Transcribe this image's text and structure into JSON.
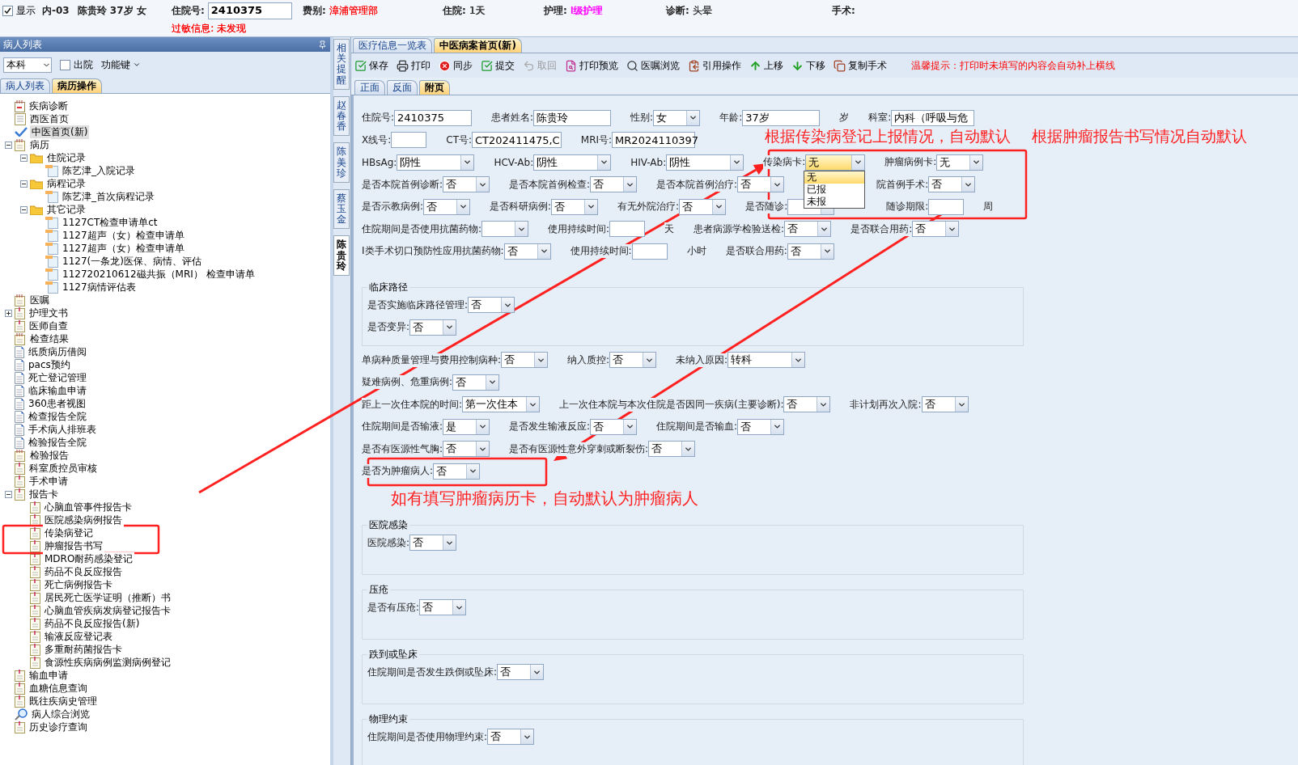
{
  "header": {
    "show_checkbox": {
      "label": "显示",
      "checked": true
    },
    "ward": "内-03",
    "patient": "陈贵玲 37岁 女",
    "fields": [
      {
        "label": "住院号:",
        "kind": "input",
        "value": "2410375"
      },
      {
        "label": "费别:",
        "kind": "text",
        "value": "漳浦管理部",
        "color": "#ff0000"
      },
      {
        "label": "住院:",
        "kind": "text",
        "value": "1天",
        "color": "#333333"
      },
      {
        "label": "护理:",
        "kind": "text",
        "value": "I级护理",
        "color": "#ff00ff"
      },
      {
        "label": "诊断:",
        "kind": "text",
        "value": "头晕",
        "color": "#333333"
      },
      {
        "label": "手术:",
        "kind": "text"
      }
    ],
    "allergy": {
      "label": "过敏信息:",
      "value": "未发现"
    }
  },
  "left_panel": {
    "title": "病人列表",
    "dept_select": "本科",
    "discharged": {
      "label": "出院",
      "checked": false
    },
    "function_menu": "功能键",
    "tabs": [
      {
        "label": "病人列表",
        "selected": false
      },
      {
        "label": "病历操作",
        "selected": true
      }
    ],
    "tree": [
      {
        "label": "疾病诊断",
        "kind": "calendar",
        "selected": false
      },
      {
        "label": "西医首页",
        "kind": "doc",
        "selected": false
      },
      {
        "label": "中医首页(新)",
        "kind": "check",
        "selected": true
      },
      {
        "label": "病历",
        "kind": "notebook",
        "selected": false,
        "expanded": true,
        "children": [
          {
            "label": "住院记录",
            "kind": "folder",
            "selected": false,
            "expanded": true,
            "children": [
              {
                "label": "陈艺津_入院记录",
                "kind": "record",
                "selected": false
              }
            ]
          },
          {
            "label": "病程记录",
            "kind": "folder",
            "selected": false,
            "expanded": true,
            "children": [
              {
                "label": "陈艺津_首次病程记录",
                "kind": "record",
                "selected": false
              }
            ]
          },
          {
            "label": "其它记录",
            "kind": "folder",
            "selected": false,
            "expanded": true,
            "children": [
              {
                "label": "1127CT检查申请单ct",
                "kind": "record",
                "selected": false
              },
              {
                "label": "1127超声（女）检查申请单",
                "kind": "record",
                "selected": false
              },
              {
                "label": "1127超声（女）检查申请单",
                "kind": "record",
                "selected": false
              },
              {
                "label": "1127(一条龙)医保、病情、评估",
                "kind": "record",
                "selected": false
              },
              {
                "label": "112720210612磁共振（MRI） 检查申请单",
                "kind": "record",
                "selected": false
              },
              {
                "label": "1127病情评估表",
                "kind": "record",
                "selected": false
              }
            ]
          }
        ]
      },
      {
        "label": "医嘱",
        "kind": "notebook",
        "selected": false
      },
      {
        "label": "护理文书",
        "kind": "clipboard",
        "selected": false,
        "expanded": false
      },
      {
        "label": "医师自查",
        "kind": "clipboard",
        "selected": false
      },
      {
        "label": "检查结果",
        "kind": "notebook",
        "selected": false
      },
      {
        "label": "纸质病历借阅",
        "kind": "page",
        "selected": false
      },
      {
        "label": "pacs预约",
        "kind": "page",
        "selected": false
      },
      {
        "label": "死亡登记管理",
        "kind": "page",
        "selected": false
      },
      {
        "label": "临床输血申请",
        "kind": "page",
        "selected": false
      },
      {
        "label": "360患者视图",
        "kind": "page",
        "selected": false
      },
      {
        "label": "检查报告全院",
        "kind": "page",
        "selected": false
      },
      {
        "label": "手术病人排班表",
        "kind": "page",
        "selected": false
      },
      {
        "label": "检验报告全院",
        "kind": "page",
        "selected": false
      },
      {
        "label": "检验报告",
        "kind": "notebook",
        "selected": false
      },
      {
        "label": "科室质控员审核",
        "kind": "clipboard",
        "selected": false
      },
      {
        "label": "手术申请",
        "kind": "clipboard",
        "selected": false
      },
      {
        "label": "报告卡",
        "kind": "clipboard",
        "selected": false,
        "expanded": true,
        "children": [
          {
            "label": "心脑血管事件报告卡",
            "kind": "clipboard",
            "selected": false
          },
          {
            "label": "医院感染病例报告",
            "kind": "clipboard",
            "selected": false
          },
          {
            "label": "传染病登记",
            "kind": "clipboard",
            "selected": false
          },
          {
            "label": "肿瘤报告书写",
            "kind": "clipboard",
            "selected": false
          },
          {
            "label": "MDRO耐药感染登记",
            "kind": "clipboard",
            "selected": false
          },
          {
            "label": "药品不良反应报告",
            "kind": "clipboard",
            "selected": false
          },
          {
            "label": "死亡病例报告卡",
            "kind": "clipboard",
            "selected": false
          },
          {
            "label": "居民死亡医学证明（推断）书",
            "kind": "clipboard",
            "selected": false
          },
          {
            "label": "心脑血管疾病发病登记报告卡",
            "kind": "clipboard",
            "selected": false
          },
          {
            "label": "药品不良反应报告(新)",
            "kind": "clipboard",
            "selected": false
          },
          {
            "label": "输液反应登记表",
            "kind": "clipboard",
            "selected": false
          },
          {
            "label": "多重耐药菌报告卡",
            "kind": "clipboard",
            "selected": false
          },
          {
            "label": "食源性疾病病例监测病例登记",
            "kind": "clipboard",
            "selected": false
          }
        ]
      },
      {
        "label": "输血申请",
        "kind": "clipboard",
        "selected": false
      },
      {
        "label": "血糖信息查询",
        "kind": "clipboard",
        "selected": false
      },
      {
        "label": "既往疾病史管理",
        "kind": "clipboard",
        "selected": false
      },
      {
        "label": "病人综合浏览",
        "kind": "search",
        "selected": false
      },
      {
        "label": "历史诊疗查询",
        "kind": "clipboard",
        "selected": false
      }
    ]
  },
  "side_tabs": [
    {
      "label": "相关提醒",
      "selected": false
    },
    {
      "label": "赵春香",
      "selected": false
    },
    {
      "label": "陈美珍",
      "selected": false
    },
    {
      "label": "蔡玉金",
      "selected": false
    },
    {
      "label": "陈贵玲",
      "selected": true
    }
  ],
  "tabs": [
    {
      "label": "医疗信息一览表",
      "selected": false
    },
    {
      "label": "中医病案首页(新)",
      "selected": true
    }
  ],
  "toolbar": [
    {
      "label": "保存",
      "disabled": false
    },
    {
      "label": "打印",
      "disabled": false
    },
    {
      "label": "同步",
      "disabled": false
    },
    {
      "label": "提交",
      "disabled": false
    },
    {
      "label": "取回",
      "disabled": true
    },
    {
      "label": "打印预览",
      "disabled": false
    },
    {
      "label": "医嘱浏览",
      "disabled": false
    },
    {
      "label": "引用操作",
      "disabled": false
    },
    {
      "label": "上移",
      "disabled": false
    },
    {
      "label": "下移",
      "disabled": false
    },
    {
      "label": "复制手术",
      "disabled": false
    }
  ],
  "tip": "温馨提示：打印时未填写的内容会自动补上横线",
  "subtabs": [
    {
      "label": "正面",
      "selected": false
    },
    {
      "label": "反面",
      "selected": false
    },
    {
      "label": "附页",
      "selected": true
    }
  ],
  "callouts": [
    "根据传染病登记上报情况，自动默认",
    "根据肿瘤报告书写情况自动默认"
  ],
  "form": [
    {
      "kind": "rows",
      "rows": [
        {
          "fields": [
            {
              "label": "住院号:",
              "kind": "input",
              "value": "2410375"
            },
            {
              "label": "患者姓名:",
              "kind": "input",
              "value": "陈贵玲"
            },
            {
              "label": "性别:",
              "kind": "select",
              "value": "女"
            },
            {
              "label": "年龄:",
              "kind": "input",
              "value": "37岁"
            },
            {
              "label": "岁",
              "kind": "unit"
            },
            {
              "label": "科室:",
              "kind": "input",
              "value": "内科（呼吸与危"
            }
          ]
        },
        {
          "fields": [
            {
              "label": "X线号:",
              "kind": "input"
            },
            {
              "label": "CT号:",
              "kind": "input",
              "value": "CT202411475,C"
            },
            {
              "label": "MRI号:",
              "kind": "input",
              "value": "MR2024110397"
            }
          ]
        },
        {
          "fields": [
            {
              "label": "HBsAg:",
              "kind": "select",
              "value": "阴性"
            },
            {
              "label": "HCV-Ab:",
              "kind": "select",
              "value": "阴性"
            },
            {
              "label": "HIV-Ab:",
              "kind": "select",
              "value": "阴性"
            },
            {
              "label": "传染病卡:",
              "kind": "select",
              "value": "无",
              "open": true,
              "options": [
                {
                  "text": "无",
                  "selected": true
                },
                {
                  "text": "已报",
                  "selected": false
                },
                {
                  "text": "未报",
                  "selected": false
                }
              ]
            },
            {
              "label": "肿瘤病例卡:",
              "kind": "select",
              "value": "无"
            }
          ]
        },
        {
          "fields": [
            {
              "label": "是否本院首例诊断:",
              "kind": "select",
              "value": "否"
            },
            {
              "label": "是否本院首例检查:",
              "kind": "select",
              "value": "否"
            },
            {
              "label": "是否本院首例治疗:",
              "kind": "select",
              "value": "否"
            },
            {
              "label": "院首例手术:",
              "kind": "select",
              "value": "否"
            }
          ]
        },
        {
          "fields": [
            {
              "label": "是否示教病例:",
              "kind": "select",
              "value": "否"
            },
            {
              "label": "是否科研病例:",
              "kind": "select",
              "value": "否"
            },
            {
              "label": "有无外院治疗:",
              "kind": "select",
              "value": "否"
            },
            {
              "label": "是否随诊:",
              "kind": "select"
            },
            {
              "label": "随诊期限:",
              "kind": "input"
            },
            {
              "label": "周",
              "kind": "unit"
            }
          ]
        },
        {
          "fields": [
            {
              "label": "住院期间是否使用抗菌药物:",
              "kind": "select"
            },
            {
              "label": "使用持续时间:",
              "kind": "input"
            },
            {
              "label": "天",
              "kind": "unit"
            },
            {
              "label": "患者病源学检验送检:",
              "kind": "select",
              "value": "否"
            },
            {
              "label": "是否联合用药:",
              "kind": "select",
              "value": "否"
            }
          ]
        },
        {
          "fields": [
            {
              "label": "I类手术切口预防性应用抗菌药物:",
              "kind": "select",
              "value": "否"
            },
            {
              "label": "使用持续时间:",
              "kind": "input"
            },
            {
              "label": "小时",
              "kind": "unit"
            },
            {
              "label": "是否联合用药:",
              "kind": "select",
              "value": "否"
            }
          ]
        }
      ]
    },
    {
      "kind": "group",
      "title": "临床路径",
      "rows": [
        {
          "fields": [
            {
              "label": "是否实施临床路径管理:",
              "kind": "select",
              "value": "否"
            }
          ]
        },
        {
          "fields": [
            {
              "label": "是否变异:",
              "kind": "select",
              "value": "否"
            }
          ]
        }
      ]
    },
    {
      "kind": "rows",
      "rows": [
        {
          "fields": [
            {
              "label": "单病种质量管理与费用控制病种:",
              "kind": "select",
              "value": "否"
            },
            {
              "label": "纳入质控:",
              "kind": "select",
              "value": "否"
            },
            {
              "label": "未纳入原因:",
              "kind": "select",
              "value": "转科"
            }
          ]
        },
        {
          "fields": [
            {
              "label": "疑难病例、危重病例:",
              "kind": "select",
              "value": "否"
            }
          ]
        },
        {
          "fields": [
            {
              "label": "距上一次住本院的时间:",
              "kind": "select",
              "value": "第一次住本"
            },
            {
              "label": "上一次住本院与本次住院是否因同一疾病(主要诊断):",
              "kind": "select",
              "value": "否"
            },
            {
              "label": "非计划再次入院:",
              "kind": "select",
              "value": "否"
            }
          ]
        },
        {
          "fields": [
            {
              "label": "住院期间是否输液:",
              "kind": "select",
              "value": "是"
            },
            {
              "label": "是否发生输液反应:",
              "kind": "select",
              "value": "否"
            },
            {
              "label": "住院期间是否输血:",
              "kind": "select",
              "value": "否"
            }
          ]
        },
        {
          "fields": [
            {
              "label": "是否有医源性气胸:",
              "kind": "select",
              "value": "否"
            },
            {
              "label": "是否有医源性意外穿刺或断裂伤:",
              "kind": "select",
              "value": "否"
            }
          ]
        },
        {
          "fields": [
            {
              "label": "是否为肿瘤病人:",
              "kind": "select",
              "value": "否"
            }
          ]
        }
      ]
    },
    {
      "kind": "note",
      "text": "如有填写肿瘤病历卡，自动默认为肿瘤病人"
    },
    {
      "kind": "group",
      "title": "医院感染",
      "rows": [
        {
          "fields": [
            {
              "label": "医院感染:",
              "kind": "select",
              "value": "否"
            }
          ]
        }
      ]
    },
    {
      "kind": "group",
      "title": "压疮",
      "rows": [
        {
          "fields": [
            {
              "label": "是否有压疮:",
              "kind": "select",
              "value": "否"
            }
          ]
        }
      ]
    },
    {
      "kind": "group",
      "title": "跌到或坠床",
      "rows": [
        {
          "fields": [
            {
              "label": "住院期间是否发生跌倒或坠床:",
              "kind": "select",
              "value": "否"
            }
          ]
        }
      ]
    },
    {
      "kind": "group",
      "title": "物理约束",
      "rows": [
        {
          "fields": [
            {
              "label": "住院期间是否使用物理约束:",
              "kind": "select",
              "value": "否"
            }
          ]
        }
      ]
    }
  ]
}
